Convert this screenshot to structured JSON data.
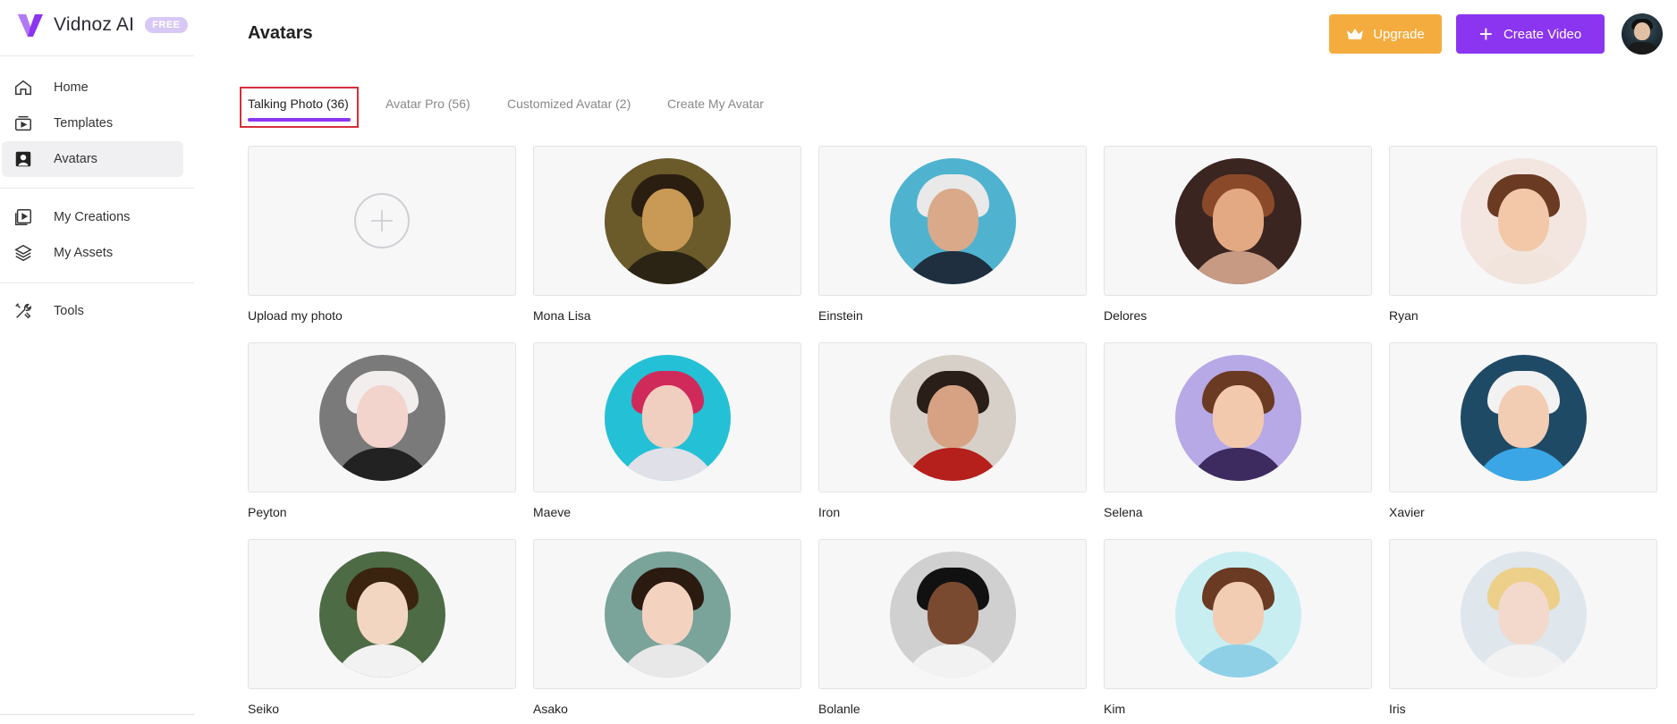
{
  "brand": {
    "name": "Vidnoz AI",
    "badge": "FREE",
    "logo_color": "#8b35f0"
  },
  "sidebar": {
    "items": [
      {
        "id": "home",
        "label": "Home",
        "icon": "home-icon",
        "active": false
      },
      {
        "id": "templates",
        "label": "Templates",
        "icon": "templates-icon",
        "active": false
      },
      {
        "id": "avatars",
        "label": "Avatars",
        "icon": "avatar-icon",
        "active": true
      },
      {
        "id": "my-creations",
        "label": "My Creations",
        "icon": "play-square-icon",
        "active": false
      },
      {
        "id": "my-assets",
        "label": "My Assets",
        "icon": "layers-icon",
        "active": false
      },
      {
        "id": "tools",
        "label": "Tools",
        "icon": "tools-icon",
        "active": false
      }
    ]
  },
  "header": {
    "title": "Avatars",
    "upgrade_label": "Upgrade",
    "create_video_label": "Create Video",
    "accent_color": "#8b35f0",
    "upgrade_color": "#f5ac3f"
  },
  "tabs": [
    {
      "label": "Talking Photo (36)",
      "active": true
    },
    {
      "label": "Avatar Pro (56)",
      "active": false
    },
    {
      "label": "Customized Avatar (2)",
      "active": false
    },
    {
      "label": "Create My Avatar",
      "active": false
    }
  ],
  "avatars": [
    {
      "label": "Upload my photo",
      "type": "upload"
    },
    {
      "label": "Mona Lisa",
      "bg": "#6b5a2a",
      "hair": "#2a1e10",
      "skin": "#c99a55",
      "shoulders": "#2b2414"
    },
    {
      "label": "Einstein",
      "bg": "#4fb3d0",
      "hair": "#e9e9e9",
      "skin": "#d9a98a",
      "shoulders": "#1f2f3f"
    },
    {
      "label": "Delores",
      "bg": "#3a2520",
      "hair": "#8a4a2a",
      "skin": "#e3a982",
      "shoulders": "#c79a84"
    },
    {
      "label": "Ryan",
      "bg": "#f3e6e0",
      "hair": "#6a3a22",
      "skin": "#f2c8a8",
      "shoulders": "#f0e4dc"
    },
    {
      "label": "Peyton",
      "bg": "#7a7a7a",
      "hair": "#f2eeee",
      "skin": "#f3d4cc",
      "shoulders": "#222"
    },
    {
      "label": "Maeve",
      "bg": "#24c0d6",
      "hair": "#d02a5a",
      "skin": "#f0cfc0",
      "shoulders": "#e0e0e8"
    },
    {
      "label": "Iron",
      "bg": "#d7d0c8",
      "hair": "#2a1f18",
      "skin": "#d7a283",
      "shoulders": "#b5201c"
    },
    {
      "label": "Selena",
      "bg": "#b7a8e6",
      "hair": "#6a3a22",
      "skin": "#f2c9ad",
      "shoulders": "#3d2b60"
    },
    {
      "label": "Xavier",
      "bg": "#1f4a66",
      "hair": "#f2f2f2",
      "skin": "#f2cdb3",
      "shoulders": "#3aa6e6"
    },
    {
      "label": "Seiko",
      "bg": "#4d6b45",
      "hair": "#3a2410",
      "skin": "#f3d6c2",
      "shoulders": "#f2f2f2"
    },
    {
      "label": "Asako",
      "bg": "#7aa39a",
      "hair": "#2a1a10",
      "skin": "#f3d3c0",
      "shoulders": "#e8e8e8"
    },
    {
      "label": "Bolanle",
      "bg": "#d0d0d0",
      "hair": "#111",
      "skin": "#7a4a30",
      "shoulders": "#f2f2f2"
    },
    {
      "label": "Kim",
      "bg": "#c8eef2",
      "hair": "#6a3a22",
      "skin": "#f2cdb3",
      "shoulders": "#8fd0e6"
    },
    {
      "label": "Iris",
      "bg": "#dfe6ec",
      "hair": "#ecd08a",
      "skin": "#f3d9cc",
      "shoulders": "#f2f2f2"
    }
  ]
}
